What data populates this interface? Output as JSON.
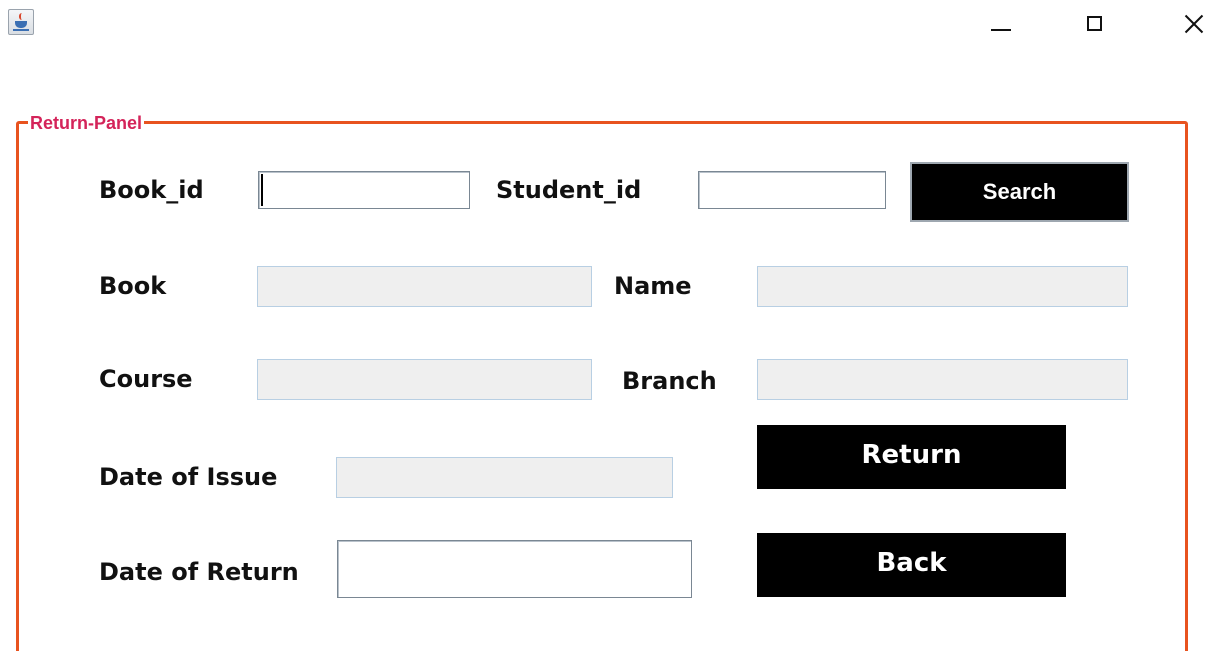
{
  "window": {
    "icon": "java-cup-icon",
    "controls": {
      "minimize": "minimize-icon",
      "maximize": "maximize-icon",
      "close": "close-icon"
    }
  },
  "panel": {
    "title": "Return-Panel",
    "border_color": "#e8531f",
    "title_color": "#d4245a"
  },
  "form": {
    "book_id_label": "Book_id",
    "book_id_value": "",
    "student_id_label": "Student_id",
    "student_id_value": "",
    "search_label": "Search",
    "book_label": "Book",
    "book_value": "",
    "name_label": "Name",
    "name_value": "",
    "course_label": "Course",
    "course_value": "",
    "branch_label": "Branch",
    "branch_value": "",
    "date_of_issue_label": "Date of Issue",
    "date_of_issue_value": "",
    "date_of_return_label": "Date of Return",
    "date_of_return_value": "",
    "return_label": "Return",
    "back_label": "Back"
  }
}
